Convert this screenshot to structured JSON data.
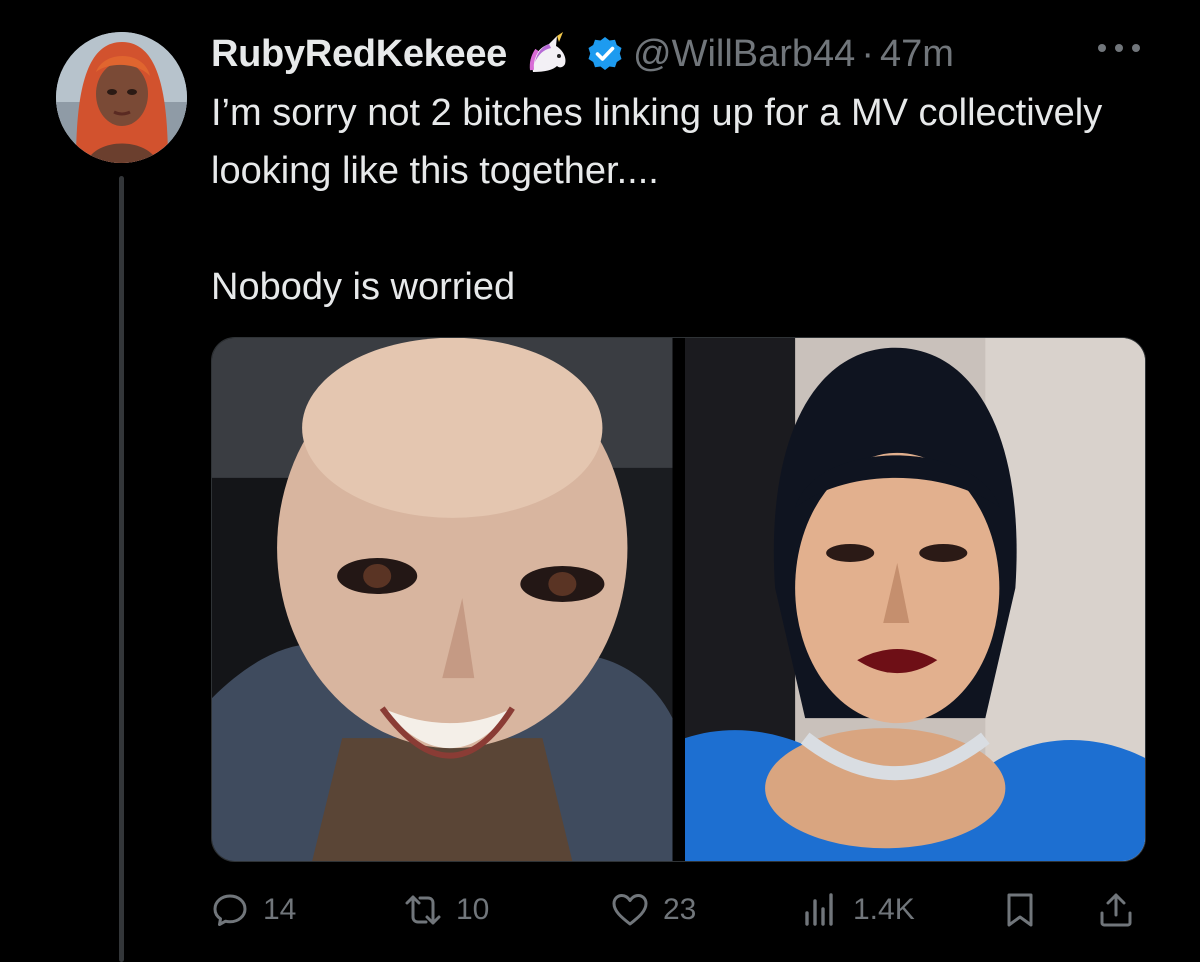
{
  "tweet": {
    "display_name": "RubyRedKekeee",
    "name_emoji": "unicorn-emoji",
    "verified_icon": "verified-badge-icon",
    "handle": "@WillBarb44",
    "separator": "·",
    "time": "47m",
    "text_line_1": "I’m sorry not 2 bitches linking up for a MV collectively looking like this together....",
    "text_line_2": "Nobody is worried"
  },
  "media": {
    "photos": [
      {
        "name": "media-photo-left"
      },
      {
        "name": "media-photo-right"
      }
    ]
  },
  "actions": {
    "replies": "14",
    "reposts": "10",
    "likes": "23",
    "views": "1.4K"
  },
  "colors": {
    "background": "#000000",
    "text": "#e7e9ea",
    "muted": "#71767b",
    "verified": "#1d9bf0",
    "thread_line": "#333639"
  }
}
